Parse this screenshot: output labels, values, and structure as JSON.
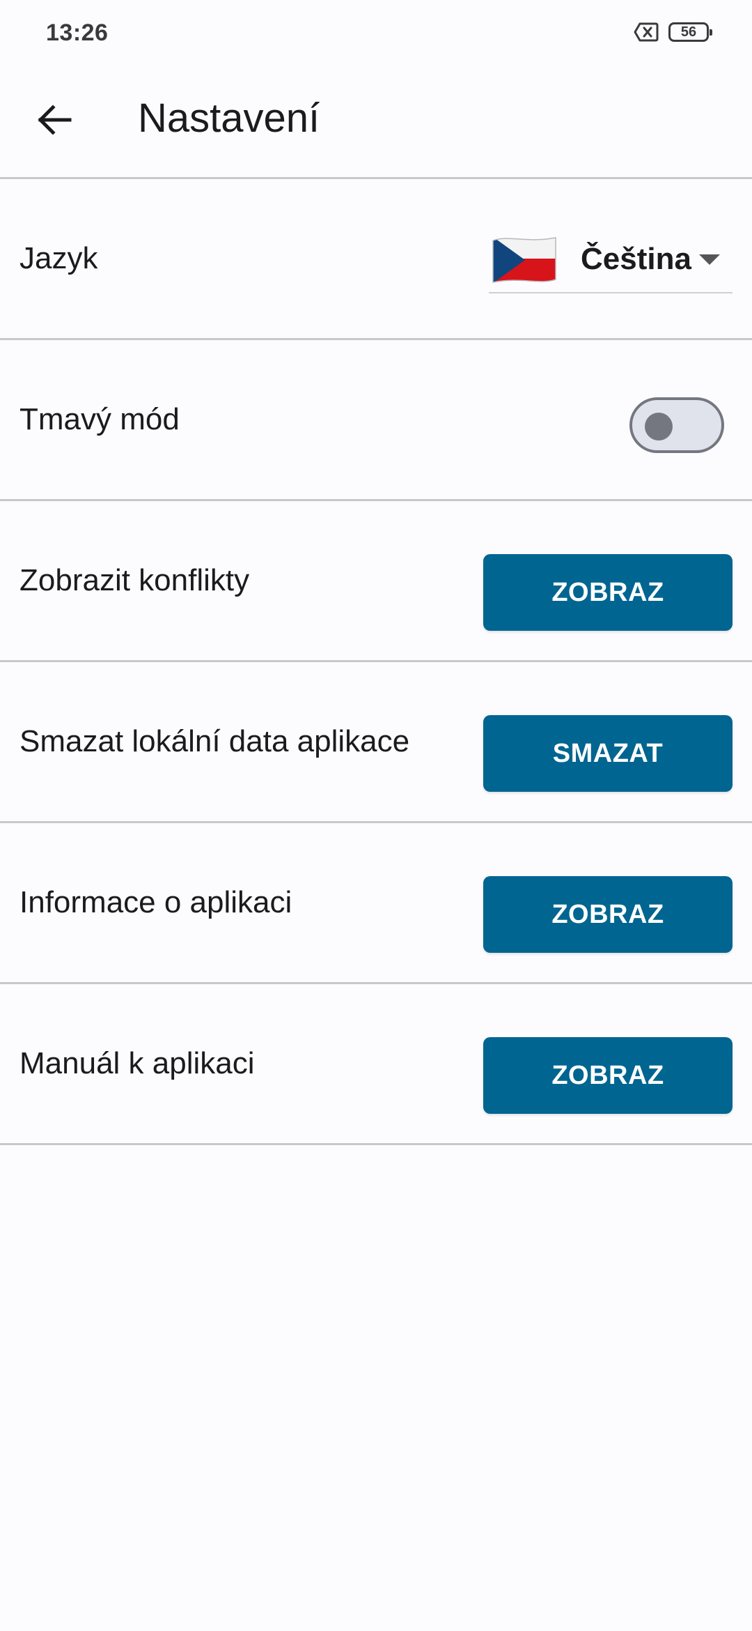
{
  "status_bar": {
    "time": "13:26",
    "battery_level": "56",
    "icons": [
      "no-sim-icon",
      "battery-icon"
    ]
  },
  "app_bar": {
    "back_icon": "arrow-left-icon",
    "title": "Nastavení"
  },
  "settings": {
    "language": {
      "label": "Jazyk",
      "selected_value": "Čeština",
      "flag_icon": "czech-flag-icon"
    },
    "dark_mode": {
      "label": "Tmavý mód",
      "enabled": false
    },
    "conflicts": {
      "label": "Zobrazit konflikty",
      "button_label": "ZOBRAZ"
    },
    "clear_data": {
      "label": "Smazat lokální data aplikace",
      "button_label": "SMAZAT"
    },
    "app_info": {
      "label": "Informace o aplikaci",
      "button_label": "ZOBRAZ"
    },
    "manual": {
      "label": "Manuál k aplikaci",
      "button_label": "ZOBRAZ"
    }
  },
  "colors": {
    "background": "#fcfcff",
    "button": "#006590",
    "button_text": "#ffffff",
    "divider": "#c7c7cc",
    "toggle_outline": "#74777f",
    "toggle_track": "#e0e2ec"
  }
}
